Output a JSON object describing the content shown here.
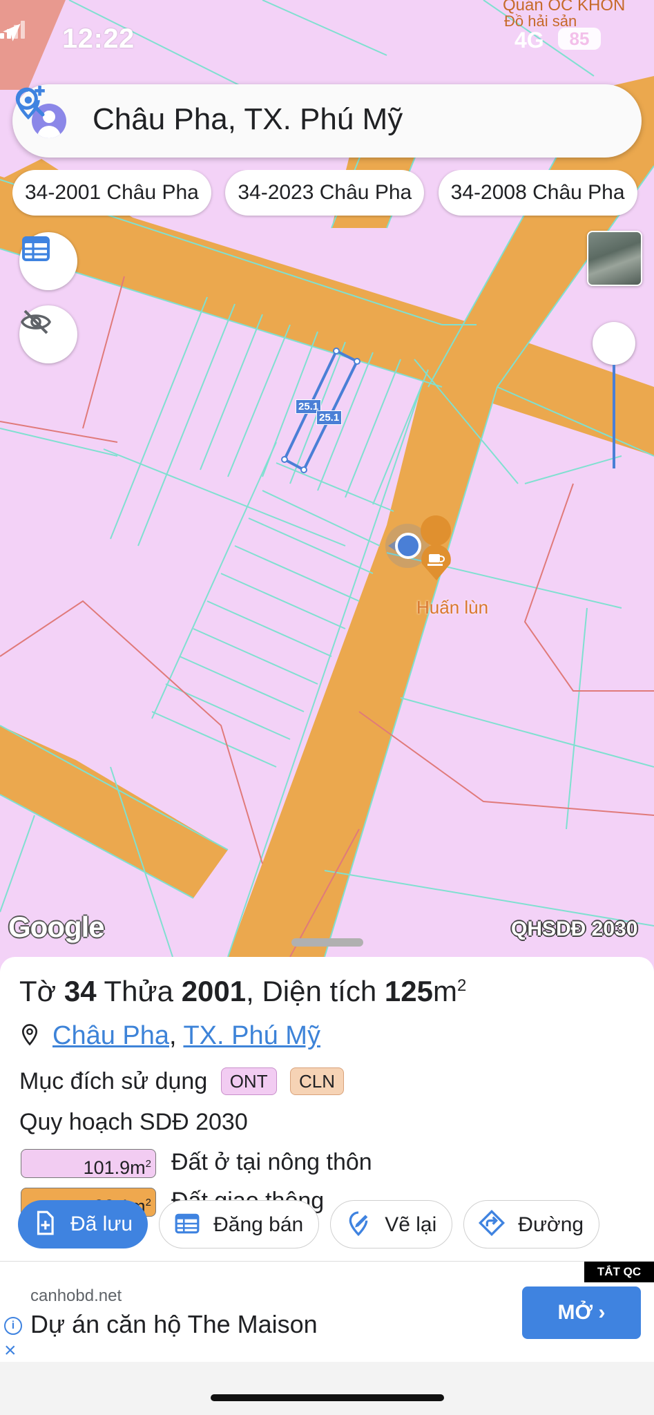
{
  "status": {
    "time": "12:22",
    "network": "4G",
    "battery": "85"
  },
  "map": {
    "corner_label_1": "Quán ỐC KHÓN",
    "corner_label_2": "Đồ hải sản",
    "poi_name": "Huấn lùn",
    "lot_tag_1": "25.1",
    "lot_tag_2": "25.1",
    "attribution": "Google",
    "plan_layer": "QHSDĐ 2030",
    "colors": {
      "residential": "#f3d2f7",
      "road": "#eba84e",
      "parcel_line": "#7fe0d0",
      "boundary": "#e07a7a",
      "selection": "#4a7fd6"
    }
  },
  "search": {
    "query": "Châu Pha, TX. Phú Mỹ",
    "search_icon": "search-icon",
    "pin_icon": "add-location-icon"
  },
  "chips": [
    "34-2001 Châu Pha",
    "34-2023 Châu Pha",
    "34-2008 Châu Pha"
  ],
  "sheet": {
    "title_prefix": "Tờ",
    "sheet_no": "34",
    "plot_label": "Thửa",
    "plot_no": "2001",
    "area_label": ", Diện tích",
    "area_value": "125",
    "area_unit": "m",
    "area_sup": "2",
    "ward": "Châu Pha",
    "comma": ",",
    "town": "TX. Phú Mỹ",
    "purpose_label": "Mục đích sử dụng",
    "purpose_badges": [
      "ONT",
      "CLN"
    ],
    "plan_title": "Quy hoạch SDĐ 2030",
    "areas": [
      {
        "value": "101.9m",
        "sup": "2",
        "label": "Đất ở tại nông thôn",
        "color": "#f2ccf2"
      },
      {
        "value": "23.1m",
        "sup": "2",
        "label": "Đất giao thông",
        "color": "#efa84e"
      }
    ]
  },
  "actions": [
    {
      "label": "Đã lưu",
      "icon": "saved-file-icon"
    },
    {
      "label": "Đăng bán",
      "icon": "listing-icon"
    },
    {
      "label": "Vẽ lại",
      "icon": "redraw-icon"
    },
    {
      "label": "Đường",
      "icon": "directions-icon"
    }
  ],
  "ad": {
    "badge": "TẮT QC",
    "domain": "canhobd.net",
    "headline": "Dự án căn hộ The Maison",
    "cta": "MỞ ›"
  }
}
